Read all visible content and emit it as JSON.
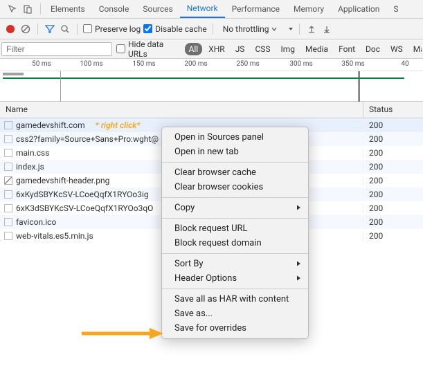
{
  "tabs": [
    "Elements",
    "Console",
    "Sources",
    "Network",
    "Performance",
    "Memory",
    "Application",
    "S"
  ],
  "active_tab": 3,
  "toolbar": {
    "preserve_log": "Preserve log",
    "disable_cache": "Disable cache",
    "throttle": "No throttling"
  },
  "filter": {
    "placeholder": "Filter",
    "hide_urls": "Hide data URLs",
    "types": [
      "All",
      "XHR",
      "JS",
      "CSS",
      "Img",
      "Media",
      "Font",
      "Doc",
      "WS",
      "Manif"
    ]
  },
  "timeline": {
    "ticks": [
      "50 ms",
      "100 ms",
      "150 ms",
      "200 ms",
      "250 ms",
      "300 ms",
      "350 ms",
      "40"
    ]
  },
  "columns": {
    "name": "Name",
    "status": "Status"
  },
  "rows": [
    {
      "name": "gamedevshift.com",
      "status": "200",
      "icon": "doc",
      "annot": "* right click*"
    },
    {
      "name": "css2?family=Source+Sans+Pro:wght@",
      "status": "200",
      "icon": "doc"
    },
    {
      "name": "main.css",
      "status": "200",
      "icon": "doc"
    },
    {
      "name": "index.js",
      "status": "200",
      "icon": "doc"
    },
    {
      "name": "gamedevshift-header.png",
      "status": "200",
      "icon": "img"
    },
    {
      "name": "6xKydSBYKcSV-LCoeQqfX1RYOo3ig",
      "status": "200",
      "icon": "doc"
    },
    {
      "name": "6xK3dSBYKcSV-LCoeQqfX1RYOo3qO",
      "status": "200",
      "icon": "doc"
    },
    {
      "name": "favicon.ico",
      "status": "200",
      "icon": "doc"
    },
    {
      "name": "web-vitals.es5.min.js",
      "status": "200",
      "icon": "doc"
    }
  ],
  "menu": [
    {
      "label": "Open in Sources panel"
    },
    {
      "label": "Open in new tab"
    },
    {
      "sep": true
    },
    {
      "label": "Clear browser cache"
    },
    {
      "label": "Clear browser cookies"
    },
    {
      "sep": true
    },
    {
      "label": "Copy",
      "submenu": true
    },
    {
      "sep": true
    },
    {
      "label": "Block request URL"
    },
    {
      "label": "Block request domain"
    },
    {
      "sep": true
    },
    {
      "label": "Sort By",
      "submenu": true
    },
    {
      "label": "Header Options",
      "submenu": true
    },
    {
      "sep": true
    },
    {
      "label": "Save all as HAR with content"
    },
    {
      "label": "Save as..."
    },
    {
      "label": "Save for overrides"
    }
  ],
  "colors": {
    "annot": "#f5a623"
  }
}
